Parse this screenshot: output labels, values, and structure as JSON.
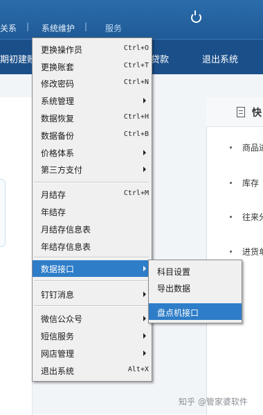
{
  "topbar": {
    "items": [
      {
        "label": "关系"
      },
      {
        "label": "系统维护"
      },
      {
        "label": "服务"
      }
    ]
  },
  "toolbar": {
    "left_label": "期初建账",
    "mid_label": "贷款",
    "logout_label": "退出系统"
  },
  "right_panel": {
    "title": "快",
    "items": [
      "商品进",
      "库存",
      "往来分",
      "进货单"
    ]
  },
  "menu": {
    "items": [
      {
        "label": "更换操作员",
        "shortcut": "Ctrl+O"
      },
      {
        "label": "更换账套",
        "shortcut": "Ctrl+T"
      },
      {
        "label": "修改密码",
        "shortcut": "Ctrl+N"
      },
      {
        "label": "系统管理",
        "submenu": true
      },
      {
        "label": "数据恢复",
        "shortcut": "Ctrl+H"
      },
      {
        "label": "数据备份",
        "shortcut": "Ctrl+B"
      },
      {
        "label": "价格体系",
        "submenu": true
      },
      {
        "label": "第三方支付",
        "submenu": true
      },
      {
        "label": "月结存",
        "shortcut": "Ctrl+M"
      },
      {
        "label": "年结存"
      },
      {
        "label": "月结存信息表"
      },
      {
        "label": "年结存信息表"
      },
      {
        "label": "数据接口",
        "submenu": true,
        "highlighted": true
      },
      {
        "label": "钉钉消息",
        "submenu": true
      },
      {
        "label": "微信公众号",
        "submenu": true
      },
      {
        "label": "短信服务",
        "submenu": true
      },
      {
        "label": "网店管理",
        "submenu": true
      },
      {
        "label": "退出系统",
        "shortcut": "Alt+X"
      }
    ]
  },
  "submenu": {
    "items": [
      {
        "label": "科目设置"
      },
      {
        "label": "导出数据"
      },
      {
        "label": "盘点机接口",
        "highlighted": true
      }
    ]
  },
  "watermark": "知乎 @管家婆软件",
  "colors": {
    "topbar": "#2b6cab",
    "toolbar": "#1a4f8a",
    "highlight": "#2e7dc8",
    "menu_bg": "#f0f0f0"
  }
}
